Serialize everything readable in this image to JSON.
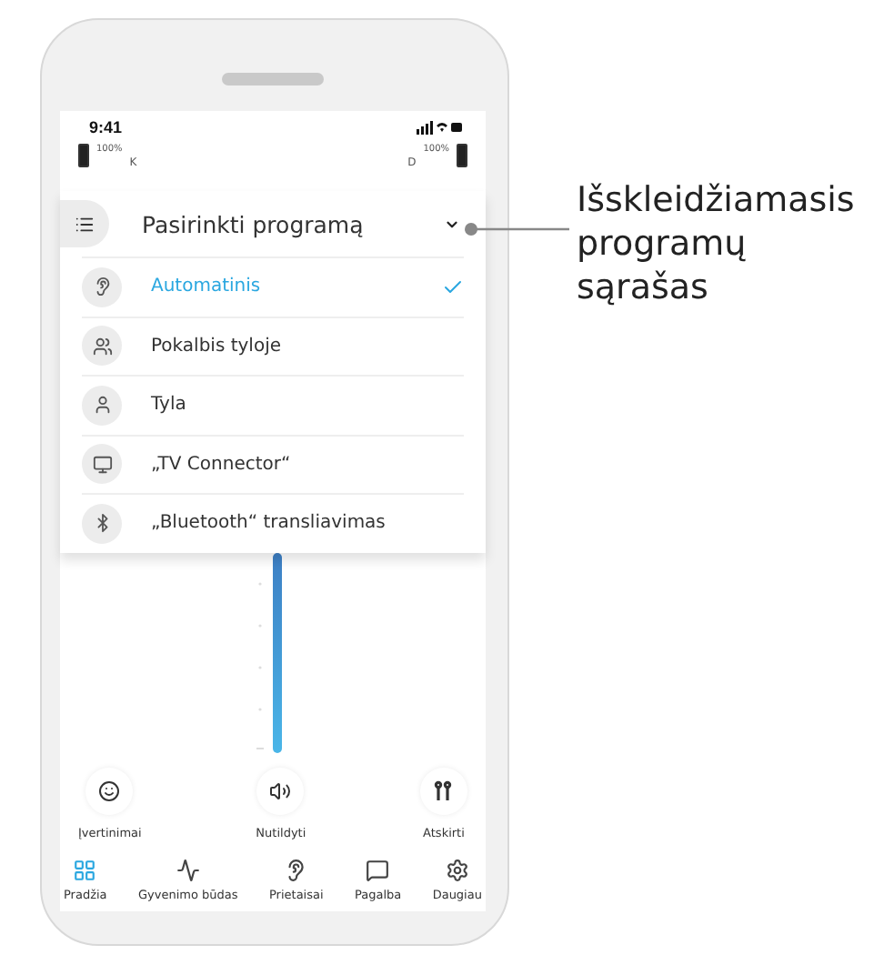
{
  "status_bar": {
    "time": "9:41"
  },
  "batteries": [
    {
      "percent": "100%",
      "side": "K"
    },
    {
      "percent": "100%",
      "side": "D"
    }
  ],
  "program_dropdown": {
    "title": "Pasirinkti programą",
    "expanded": true,
    "programs": [
      {
        "label": "Automatinis",
        "selected": true
      },
      {
        "label": "Pokalbis tyloje",
        "selected": false
      },
      {
        "label": "Tyla",
        "selected": false
      },
      {
        "label": "„TV Connector“",
        "selected": false
      },
      {
        "label": "„Bluetooth“ transliavimas",
        "selected": false
      }
    ]
  },
  "actions": [
    {
      "label": "Įvertinimai"
    },
    {
      "label": "Nutildyti"
    },
    {
      "label": "Atskirti"
    }
  ],
  "bottom_nav": [
    {
      "label": "Pradžia",
      "selected": true
    },
    {
      "label": "Gyvenimo būdas",
      "selected": false
    },
    {
      "label": "Prietaisai",
      "selected": false
    },
    {
      "label": "Pagalba",
      "selected": false
    },
    {
      "label": "Daugiau",
      "selected": false
    }
  ],
  "callout": {
    "lines": [
      "Išskleidžiamasis",
      "programų",
      "sąrašas"
    ]
  }
}
